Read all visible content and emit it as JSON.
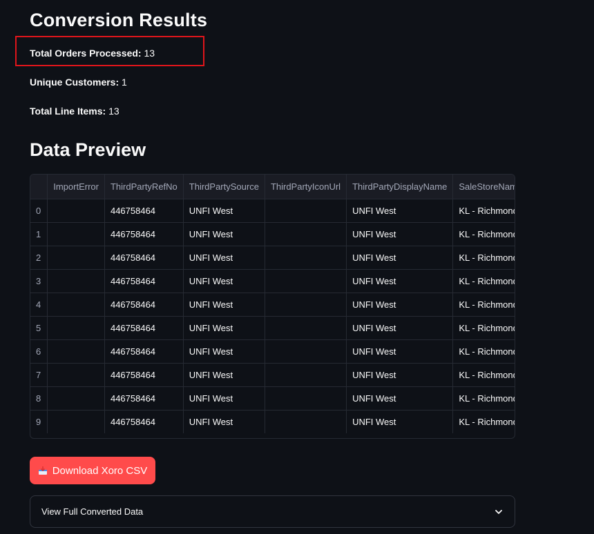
{
  "results": {
    "title": "Conversion Results",
    "stats": [
      {
        "label": "Total Orders Processed:",
        "value": "13"
      },
      {
        "label": "Unique Customers:",
        "value": "1"
      },
      {
        "label": "Total Line Items:",
        "value": "13"
      }
    ]
  },
  "preview": {
    "title": "Data Preview",
    "columns": [
      "",
      "ImportError",
      "ThirdPartyRefNo",
      "ThirdPartySource",
      "ThirdPartyIconUrl",
      "ThirdPartyDisplayName",
      "SaleStoreName"
    ],
    "rows": [
      [
        "0",
        "",
        "446758464",
        "UNFI West",
        "",
        "UNFI West",
        "KL - Richmond"
      ],
      [
        "1",
        "",
        "446758464",
        "UNFI West",
        "",
        "UNFI West",
        "KL - Richmond"
      ],
      [
        "2",
        "",
        "446758464",
        "UNFI West",
        "",
        "UNFI West",
        "KL - Richmond"
      ],
      [
        "3",
        "",
        "446758464",
        "UNFI West",
        "",
        "UNFI West",
        "KL - Richmond"
      ],
      [
        "4",
        "",
        "446758464",
        "UNFI West",
        "",
        "UNFI West",
        "KL - Richmond"
      ],
      [
        "5",
        "",
        "446758464",
        "UNFI West",
        "",
        "UNFI West",
        "KL - Richmond"
      ],
      [
        "6",
        "",
        "446758464",
        "UNFI West",
        "",
        "UNFI West",
        "KL - Richmond"
      ],
      [
        "7",
        "",
        "446758464",
        "UNFI West",
        "",
        "UNFI West",
        "KL - Richmond"
      ],
      [
        "8",
        "",
        "446758464",
        "UNFI West",
        "",
        "UNFI West",
        "KL - Richmond"
      ],
      [
        "9",
        "",
        "446758464",
        "UNFI West",
        "",
        "UNFI West",
        "KL - Richmond"
      ]
    ]
  },
  "download": {
    "label": "Download Xoro CSV",
    "icon": "inbox-tray-icon"
  },
  "expander": {
    "label": "View Full Converted Data",
    "icon": "chevron-down-icon"
  },
  "colors": {
    "accent": "#ff4b4b",
    "highlight": "#e0151b",
    "background": "#0e1117"
  }
}
